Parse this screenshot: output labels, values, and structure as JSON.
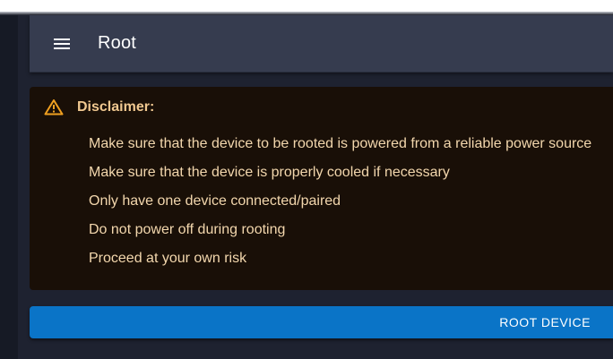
{
  "app_bar": {
    "title": "Root",
    "menu_icon": "hamburger-menu-icon"
  },
  "disclaimer": {
    "icon": "warning-triangle-icon",
    "title": "Disclaimer:",
    "items": [
      "Make sure that the device to be rooted is powered from a reliable power source",
      "Make sure that the device is properly cooled if necessary",
      "Only have one device connected/paired",
      "Do not power off during rooting",
      "Proceed at your own risk"
    ]
  },
  "actions": {
    "root_label": "ROOT DEVICE"
  },
  "colors": {
    "app_bar": "#363c4f",
    "background": "#1e2230",
    "warning_background": "#190f07",
    "warning_text": "#f3d7ad",
    "warning_icon": "#f0a020",
    "primary_button": "#0a74c7"
  }
}
